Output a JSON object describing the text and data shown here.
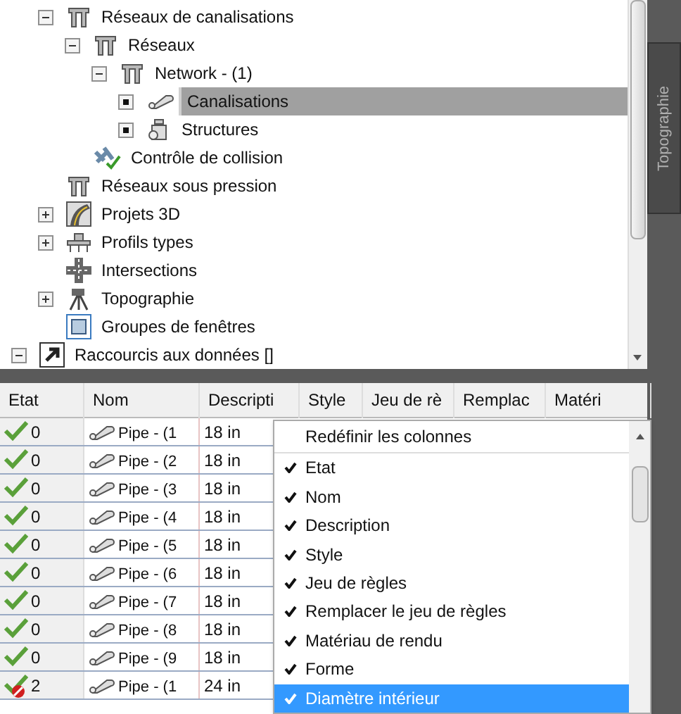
{
  "tree": {
    "items": [
      {
        "label": "Réseaux de canalisations",
        "kind": "network",
        "expanded": true,
        "selected": false,
        "children": [
          {
            "label": "Réseaux",
            "kind": "network",
            "expanded": true,
            "selected": false,
            "children": [
              {
                "label": "Network - (1)",
                "kind": "network",
                "expanded": true,
                "selected": false,
                "children": [
                  {
                    "label": "Canalisations",
                    "kind": "pipes",
                    "bullet": true,
                    "selected": true
                  },
                  {
                    "label": "Structures",
                    "kind": "structures",
                    "bullet": true,
                    "selected": false
                  }
                ]
              }
            ]
          },
          {
            "label": "Contrôle de collision",
            "kind": "collision",
            "selected": false
          }
        ]
      },
      {
        "label": "Réseaux sous pression",
        "kind": "network",
        "selected": false
      },
      {
        "label": "Projets 3D",
        "kind": "corridor",
        "expanded": false,
        "selected": false
      },
      {
        "label": "Profils types",
        "kind": "assembly",
        "expanded": false,
        "selected": false
      },
      {
        "label": "Intersections",
        "kind": "intersection",
        "selected": false
      },
      {
        "label": "Topographie",
        "kind": "survey",
        "expanded": false,
        "selected": false
      },
      {
        "label": "Groupes de fenêtres",
        "kind": "view_frames",
        "selected": false
      }
    ],
    "root_items": [
      {
        "label": "Raccourcis aux données []",
        "kind": "shortcut",
        "expanded": true,
        "selected": false
      }
    ]
  },
  "side_tab": {
    "label": "Topographie"
  },
  "table": {
    "columns": [
      "Etat",
      "Nom",
      "Descripti",
      "Style",
      "Jeu de rè",
      "Remplac",
      "Matéri"
    ],
    "rows": [
      {
        "error": false,
        "etat": "0",
        "nom": "Pipe - (1",
        "description": "18 in"
      },
      {
        "error": false,
        "etat": "0",
        "nom": "Pipe - (2",
        "description": "18 in"
      },
      {
        "error": false,
        "etat": "0",
        "nom": "Pipe - (3",
        "description": "18 in"
      },
      {
        "error": false,
        "etat": "0",
        "nom": "Pipe - (4",
        "description": "18 in"
      },
      {
        "error": false,
        "etat": "0",
        "nom": "Pipe - (5",
        "description": "18 in"
      },
      {
        "error": false,
        "etat": "0",
        "nom": "Pipe - (6",
        "description": "18 in"
      },
      {
        "error": false,
        "etat": "0",
        "nom": "Pipe - (7",
        "description": "18 in"
      },
      {
        "error": false,
        "etat": "0",
        "nom": "Pipe - (8",
        "description": "18 in"
      },
      {
        "error": false,
        "etat": "0",
        "nom": "Pipe - (9",
        "description": "18 in"
      },
      {
        "error": true,
        "etat": "2",
        "nom": "Pipe - (1",
        "description": "24 in"
      }
    ]
  },
  "context_menu": {
    "title": "Redéfinir les colonnes",
    "items": [
      {
        "label": "Etat",
        "checked": true,
        "selected": false
      },
      {
        "label": "Nom",
        "checked": true,
        "selected": false
      },
      {
        "label": "Description",
        "checked": true,
        "selected": false
      },
      {
        "label": "Style",
        "checked": true,
        "selected": false
      },
      {
        "label": "Jeu de règles",
        "checked": true,
        "selected": false
      },
      {
        "label": "Remplacer le jeu de règles",
        "checked": true,
        "selected": false
      },
      {
        "label": "Matériau de rendu",
        "checked": true,
        "selected": false
      },
      {
        "label": "Forme",
        "checked": true,
        "selected": false
      },
      {
        "label": "Diamètre intérieur",
        "checked": true,
        "selected": true
      }
    ]
  }
}
